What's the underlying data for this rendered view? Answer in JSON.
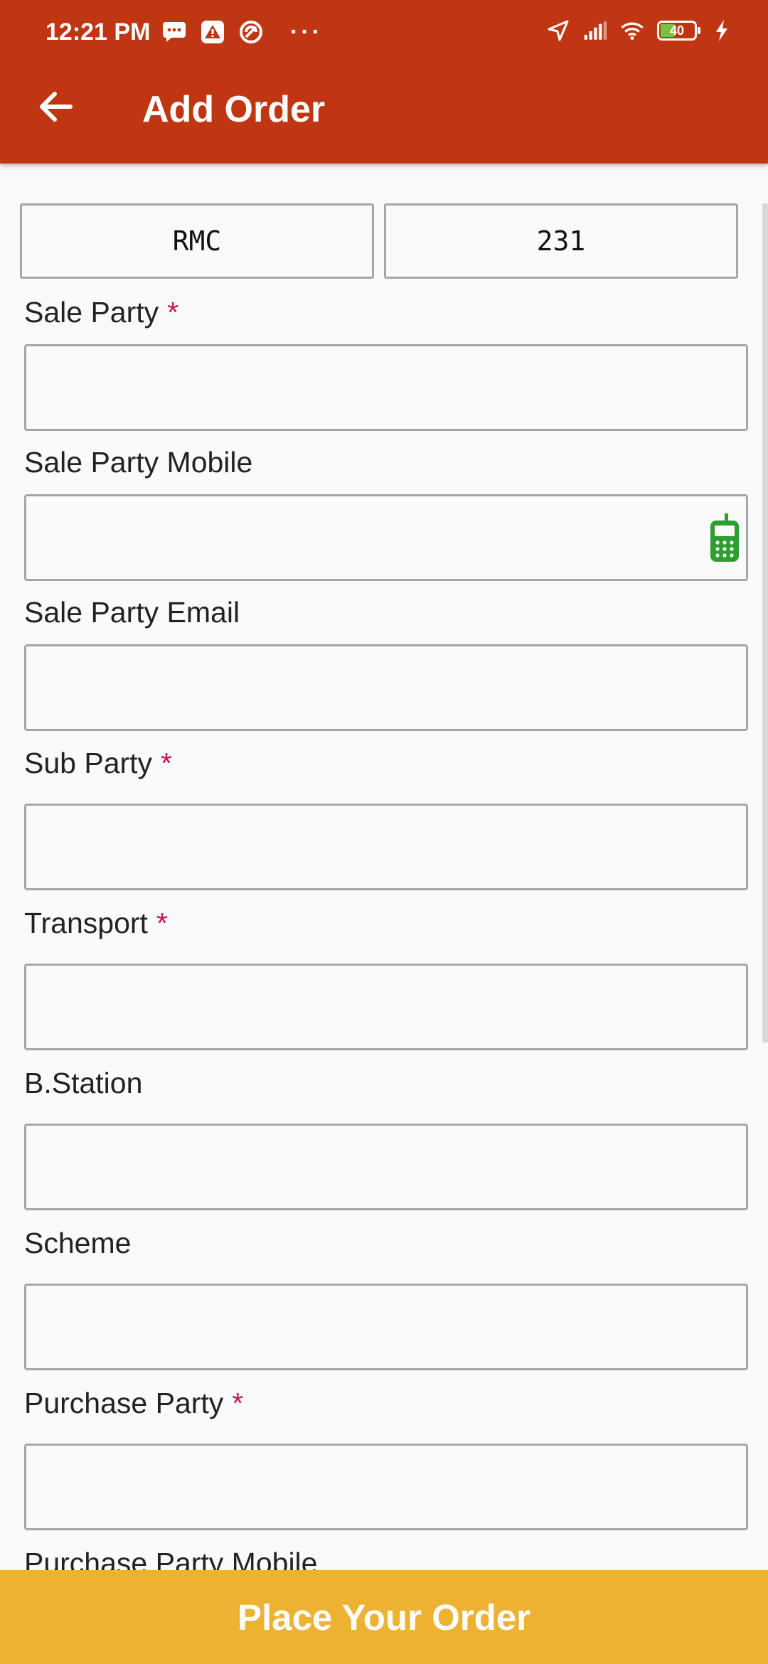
{
  "status_bar": {
    "time": "12:21 PM",
    "battery": "40"
  },
  "header": {
    "title": "Add Order"
  },
  "top_fields": {
    "left_value": "RMC",
    "right_value": "231"
  },
  "form": {
    "fields": [
      {
        "label": "Sale Party",
        "required": "*"
      },
      {
        "label": "Sale Party Mobile",
        "required": ""
      },
      {
        "label": "Sale Party Email",
        "required": ""
      },
      {
        "label": "Sub Party",
        "required": "*"
      },
      {
        "label": "Transport",
        "required": "*"
      },
      {
        "label": "B.Station",
        "required": ""
      },
      {
        "label": "Scheme",
        "required": ""
      },
      {
        "label": "Purchase Party",
        "required": "*"
      },
      {
        "label": "Purchase Party Mobile",
        "required": ""
      }
    ]
  },
  "footer": {
    "button_label": "Place Your Order"
  },
  "colors": {
    "appbar": "#c13612",
    "button": "#edb232",
    "required": "#c2185b",
    "phone_icon": "#2e9e2e"
  }
}
